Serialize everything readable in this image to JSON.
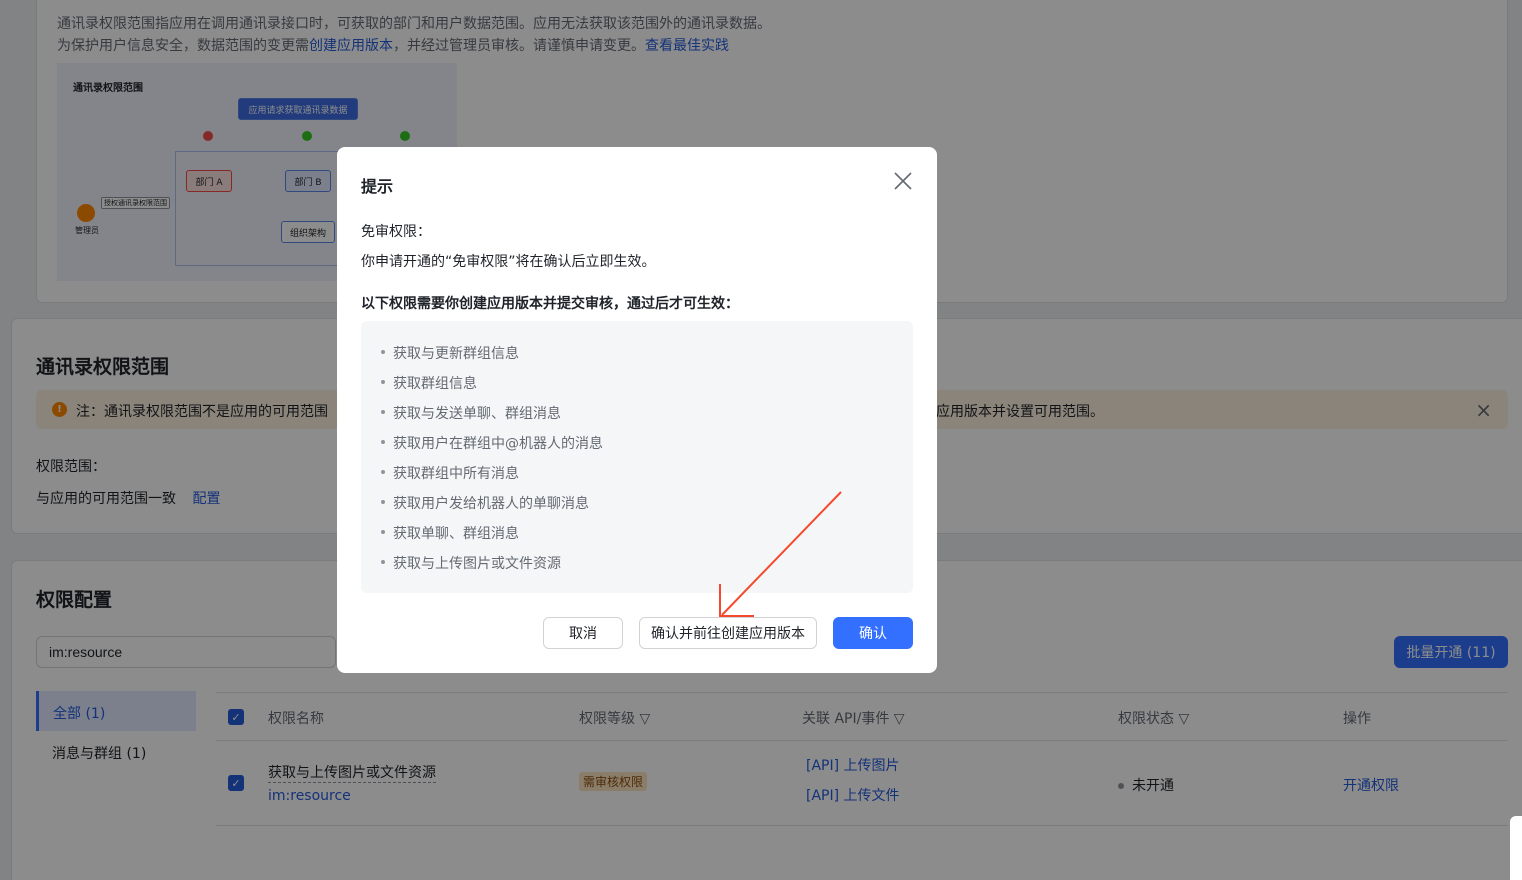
{
  "intro": {
    "line1": "通讯录权限范围指应用在调用通讯录接口时，可获取的部门和用户数据范围。应用无法获取该范围外的通讯录数据。",
    "line2_prefix": "为保护用户信息安全，数据范围的变更需",
    "line2_link1": "创建应用版本",
    "line2_mid": "，并经过管理员审核。请谨慎申请变更。",
    "line2_link2": "查看最佳实践"
  },
  "diagram": {
    "title": "通讯录权限范围",
    "request": "应用请求获取通讯录数据",
    "dept_a": "部门 A",
    "dept_b": "部门 B",
    "org": "组织架构",
    "admin": "管理员",
    "grant": "授权通讯录权限范围"
  },
  "scope": {
    "title": "通讯录权限范围",
    "notice": "注：通讯录权限范围不是应用的可用范围",
    "notice_tail": "应用版本并设置可用范围。",
    "label": "权限范围：",
    "value": "与应用的可用范围一致",
    "config": "配置"
  },
  "perm": {
    "title": "权限配置",
    "search_value": "im:resource",
    "bulk_button": "批量开通 (11)",
    "categories": [
      "全部 (1)",
      "消息与群组 (1)"
    ],
    "headers": {
      "name": "权限名称",
      "level": "权限等级",
      "api": "关联 API/事件",
      "status": "权限状态",
      "action": "操作"
    },
    "row": {
      "name": "获取与上传图片或文件资源",
      "code": "im:resource",
      "level": "需审核权限",
      "api1": "[API] 上传图片",
      "api2": "[API] 上传文件",
      "status": "未开通",
      "action": "开通权限"
    }
  },
  "modal": {
    "title": "提示",
    "section1_title": "免审权限：",
    "section1_body": "你申请开通的“免审权限”将在确认后立即生效。",
    "section2_title": "以下权限需要你创建应用版本并提交审核，通过后才可生效：",
    "items": [
      "获取与更新群组信息",
      "获取群组信息",
      "获取与发送单聊、群组消息",
      "获取用户在群组中@机器人的消息",
      "获取群组中所有消息",
      "获取用户发给机器人的单聊消息",
      "获取单聊、群组消息",
      "获取与上传图片或文件资源"
    ],
    "cancel": "取消",
    "confirm_create": "确认并前往创建应用版本",
    "confirm": "确认"
  },
  "colors": {
    "primary": "#3370ff",
    "link": "#245bdb",
    "warn_bg": "#fdf0de",
    "warn_icon": "#ff8800",
    "tag_bg": "#fce4c2",
    "arrow": "#f54a2e"
  }
}
